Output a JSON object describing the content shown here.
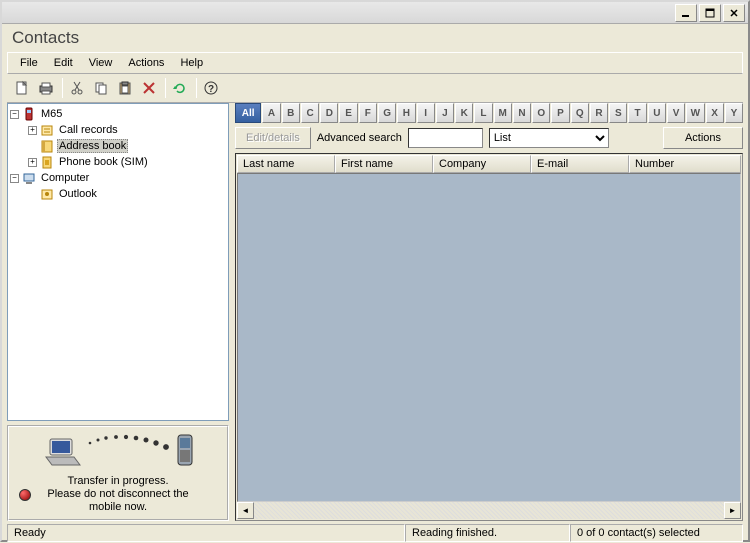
{
  "window": {
    "title": "Contacts"
  },
  "menu": {
    "file": "File",
    "edit": "Edit",
    "view": "View",
    "actions": "Actions",
    "help": "Help"
  },
  "tree": {
    "root_device": "M65",
    "call_records": "Call records",
    "address_book": "Address book",
    "phone_book_sim": "Phone book (SIM)",
    "computer": "Computer",
    "outlook": "Outlook"
  },
  "transfer": {
    "line1": "Transfer in progress.",
    "line2": "Please do not disconnect the",
    "line3": "mobile now."
  },
  "alpha": {
    "all": "All",
    "letters": [
      "A",
      "B",
      "C",
      "D",
      "E",
      "F",
      "G",
      "H",
      "I",
      "J",
      "K",
      "L",
      "M",
      "N",
      "O",
      "P",
      "Q",
      "R",
      "S",
      "T",
      "U",
      "V",
      "W",
      "X",
      "Y"
    ]
  },
  "search": {
    "edit_details": "Edit/details",
    "advanced": "Advanced search",
    "input_value": "",
    "list_option": "List",
    "actions": "Actions"
  },
  "columns": {
    "last_name": "Last name",
    "first_name": "First name",
    "company": "Company",
    "email": "E-mail",
    "number": "Number"
  },
  "status": {
    "ready": "Ready",
    "reading": "Reading finished.",
    "selection": "0 of 0 contact(s) selected"
  }
}
